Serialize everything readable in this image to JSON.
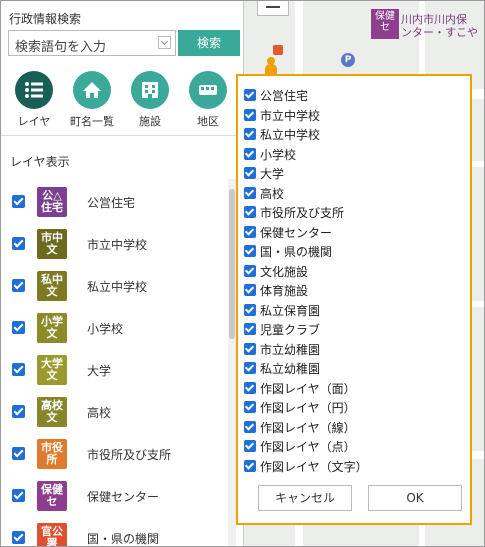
{
  "search": {
    "title": "行政情報検索",
    "placeholder": "検索語句を入力",
    "button": "検索"
  },
  "tools": [
    {
      "label": "レイヤ",
      "icon": "list-icon"
    },
    {
      "label": "町名一覧",
      "icon": "home-icon"
    },
    {
      "label": "施設",
      "icon": "building-icon"
    },
    {
      "label": "地区",
      "icon": "bus-icon"
    }
  ],
  "layer_section_title": "レイヤ表示",
  "layers": [
    {
      "label": "公営住宅",
      "icon_text": "公△住宅",
      "color": "#7b3f8f"
    },
    {
      "label": "市立中学校",
      "icon_text": "市中文",
      "color": "#6b6a1f"
    },
    {
      "label": "私立中学校",
      "icon_text": "私中文",
      "color": "#7e7a24"
    },
    {
      "label": "小学校",
      "icon_text": "小学文",
      "color": "#8d8a29"
    },
    {
      "label": "大学",
      "icon_text": "大学文",
      "color": "#9a9a2e"
    },
    {
      "label": "高校",
      "icon_text": "高校文",
      "color": "#86872a"
    },
    {
      "label": "市役所及び支所",
      "icon_text": "市役所",
      "color": "#e07a2c"
    },
    {
      "label": "保健センター",
      "icon_text": "保健セ",
      "color": "#8d3f8e"
    },
    {
      "label": "国・県の機関",
      "icon_text": "官公署",
      "color": "#e0502c"
    }
  ],
  "map": {
    "poi_marker": "保健セ",
    "poi_label_1": "川内市川内保",
    "poi_label_2": "ンター・すこや",
    "parking": "P"
  },
  "popup": {
    "options": [
      "公営住宅",
      "市立中学校",
      "私立中学校",
      "小学校",
      "大学",
      "高校",
      "市役所及び支所",
      "保健センター",
      "国・県の機関",
      "文化施設",
      "体育施設",
      "私立保育園",
      "児童クラブ",
      "市立幼稚園",
      "私立幼稚園",
      "作図レイヤ（面）",
      "作図レイヤ（円）",
      "作図レイヤ（線）",
      "作図レイヤ（点）",
      "作図レイヤ（文字）"
    ],
    "cancel": "キャンセル",
    "ok": "OK"
  }
}
